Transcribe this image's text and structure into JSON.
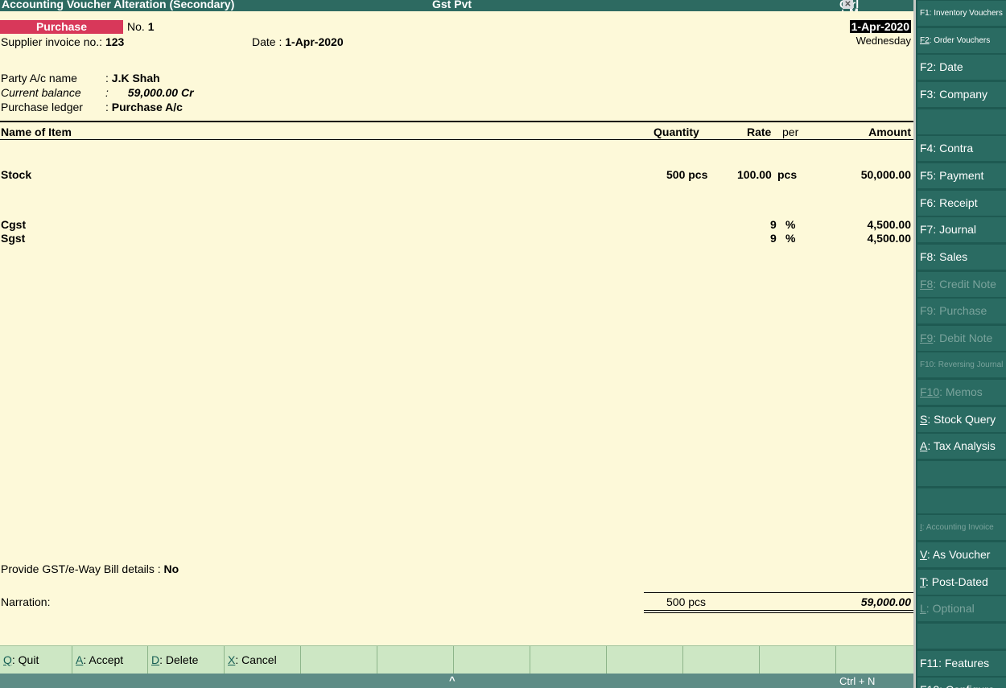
{
  "title_bar": {
    "title": "Accounting Voucher  Alteration  (Secondary)",
    "company": "Gst Pvt",
    "shortcut": "Ctrl + M",
    "close_glyph": "✕"
  },
  "voucher": {
    "type": "Purchase",
    "no_label": "No.",
    "no_value": "1",
    "date_top": "1-Apr-2020",
    "weekday": "Wednesday",
    "supplier_invoice_label": "Supplier invoice no.:",
    "supplier_invoice_value": "123",
    "date_label": "Date  :",
    "date_value": "1-Apr-2020",
    "party_label": "Party A/c name",
    "party_value": "J.K Shah",
    "balance_label": "Current balance",
    "balance_value": "59,000.00 Cr",
    "ledger_label": "Purchase ledger",
    "ledger_value": "Purchase A/c",
    "sep": ":"
  },
  "table": {
    "headers": {
      "item": "Name of Item",
      "quantity": "Quantity",
      "rate": "Rate",
      "per": "per",
      "amount": "Amount"
    },
    "rows": [
      {
        "item": "Stock",
        "quantity": "500 pcs",
        "rate": "100.00",
        "per": "pcs",
        "amount": "50,000.00"
      }
    ],
    "taxes": [
      {
        "name": "Cgst",
        "rate": "9",
        "unit": "%",
        "amount": "4,500.00"
      },
      {
        "name": "Sgst",
        "rate": "9",
        "unit": "%",
        "amount": "4,500.00"
      }
    ]
  },
  "footer_fields": {
    "gst_label": "Provide GST/e-Way Bill details :",
    "gst_value": "No",
    "narration_label": "Narration:",
    "total_quantity": "500 pcs",
    "total_amount": "59,000.00"
  },
  "buttons": [
    {
      "key": "Q",
      "label": ": Quit"
    },
    {
      "key": "A",
      "label": ": Accept"
    },
    {
      "key": "D",
      "label": ": Delete"
    },
    {
      "key": "X",
      "label": ": Cancel"
    }
  ],
  "status_bar": {
    "caret": "^",
    "shortcut": "Ctrl + N"
  },
  "sidebar": [
    {
      "key": "F1",
      "label": ": Inventory Vouchers",
      "dim": false,
      "small": true,
      "underline": false
    },
    {
      "key": "F2",
      "label": ": Order Vouchers",
      "dim": false,
      "small": true,
      "underline": true
    },
    {
      "key": "F2",
      "label": ": Date",
      "dim": false,
      "small": false,
      "underline": false
    },
    {
      "key": "F3",
      "label": ": Company",
      "dim": false,
      "small": false,
      "underline": false
    },
    {
      "key": "",
      "label": "",
      "dim": false,
      "small": false,
      "underline": false
    },
    {
      "key": "F4",
      "label": ": Contra",
      "dim": false,
      "small": false,
      "underline": false
    },
    {
      "key": "F5",
      "label": ": Payment",
      "dim": false,
      "small": false,
      "underline": false
    },
    {
      "key": "F6",
      "label": ": Receipt",
      "dim": false,
      "small": false,
      "underline": false
    },
    {
      "key": "F7",
      "label": ": Journal",
      "dim": false,
      "small": false,
      "underline": false
    },
    {
      "key": "F8",
      "label": ": Sales",
      "dim": false,
      "small": false,
      "underline": false
    },
    {
      "key": "F8",
      "label": ": Credit Note",
      "dim": true,
      "small": false,
      "underline": true
    },
    {
      "key": "F9",
      "label": ": Purchase",
      "dim": true,
      "small": false,
      "underline": false
    },
    {
      "key": "F9",
      "label": ": Debit Note",
      "dim": true,
      "small": false,
      "underline": true
    },
    {
      "key": "F10",
      "label": ": Reversing Journal",
      "dim": true,
      "small": true,
      "underline": false
    },
    {
      "key": "F10",
      "label": ": Memos",
      "dim": true,
      "small": false,
      "underline": true
    },
    {
      "key": "S",
      "label": ": Stock Query",
      "dim": false,
      "small": false,
      "underline": true
    },
    {
      "key": "A",
      "label": ": Tax Analysis",
      "dim": false,
      "small": false,
      "underline": true
    },
    {
      "key": "",
      "label": "",
      "dim": false,
      "small": false,
      "underline": false
    },
    {
      "key": "",
      "label": "",
      "dim": false,
      "small": false,
      "underline": false
    },
    {
      "key": "I",
      "label": ": Accounting Invoice",
      "dim": true,
      "small": true,
      "underline": true
    },
    {
      "key": "V",
      "label": ": As Voucher",
      "dim": false,
      "small": false,
      "underline": true
    },
    {
      "key": "T",
      "label": ": Post-Dated",
      "dim": false,
      "small": false,
      "underline": true
    },
    {
      "key": "L",
      "label": ": Optional",
      "dim": true,
      "small": false,
      "underline": true
    },
    {
      "key": "",
      "label": "",
      "dim": false,
      "small": false,
      "underline": false
    },
    {
      "key": "F11",
      "label": ": Features",
      "dim": false,
      "small": false,
      "underline": false
    },
    {
      "key": "F12",
      "label": ": Configure",
      "dim": false,
      "small": false,
      "underline": false
    }
  ],
  "colors": {
    "panel_bg": "#fdf9d9",
    "title_bg": "#2d6a61",
    "voucher_badge": "#d8385a",
    "button_bar": "#cde7c4",
    "sidebar_bg": "#2a6b62"
  }
}
